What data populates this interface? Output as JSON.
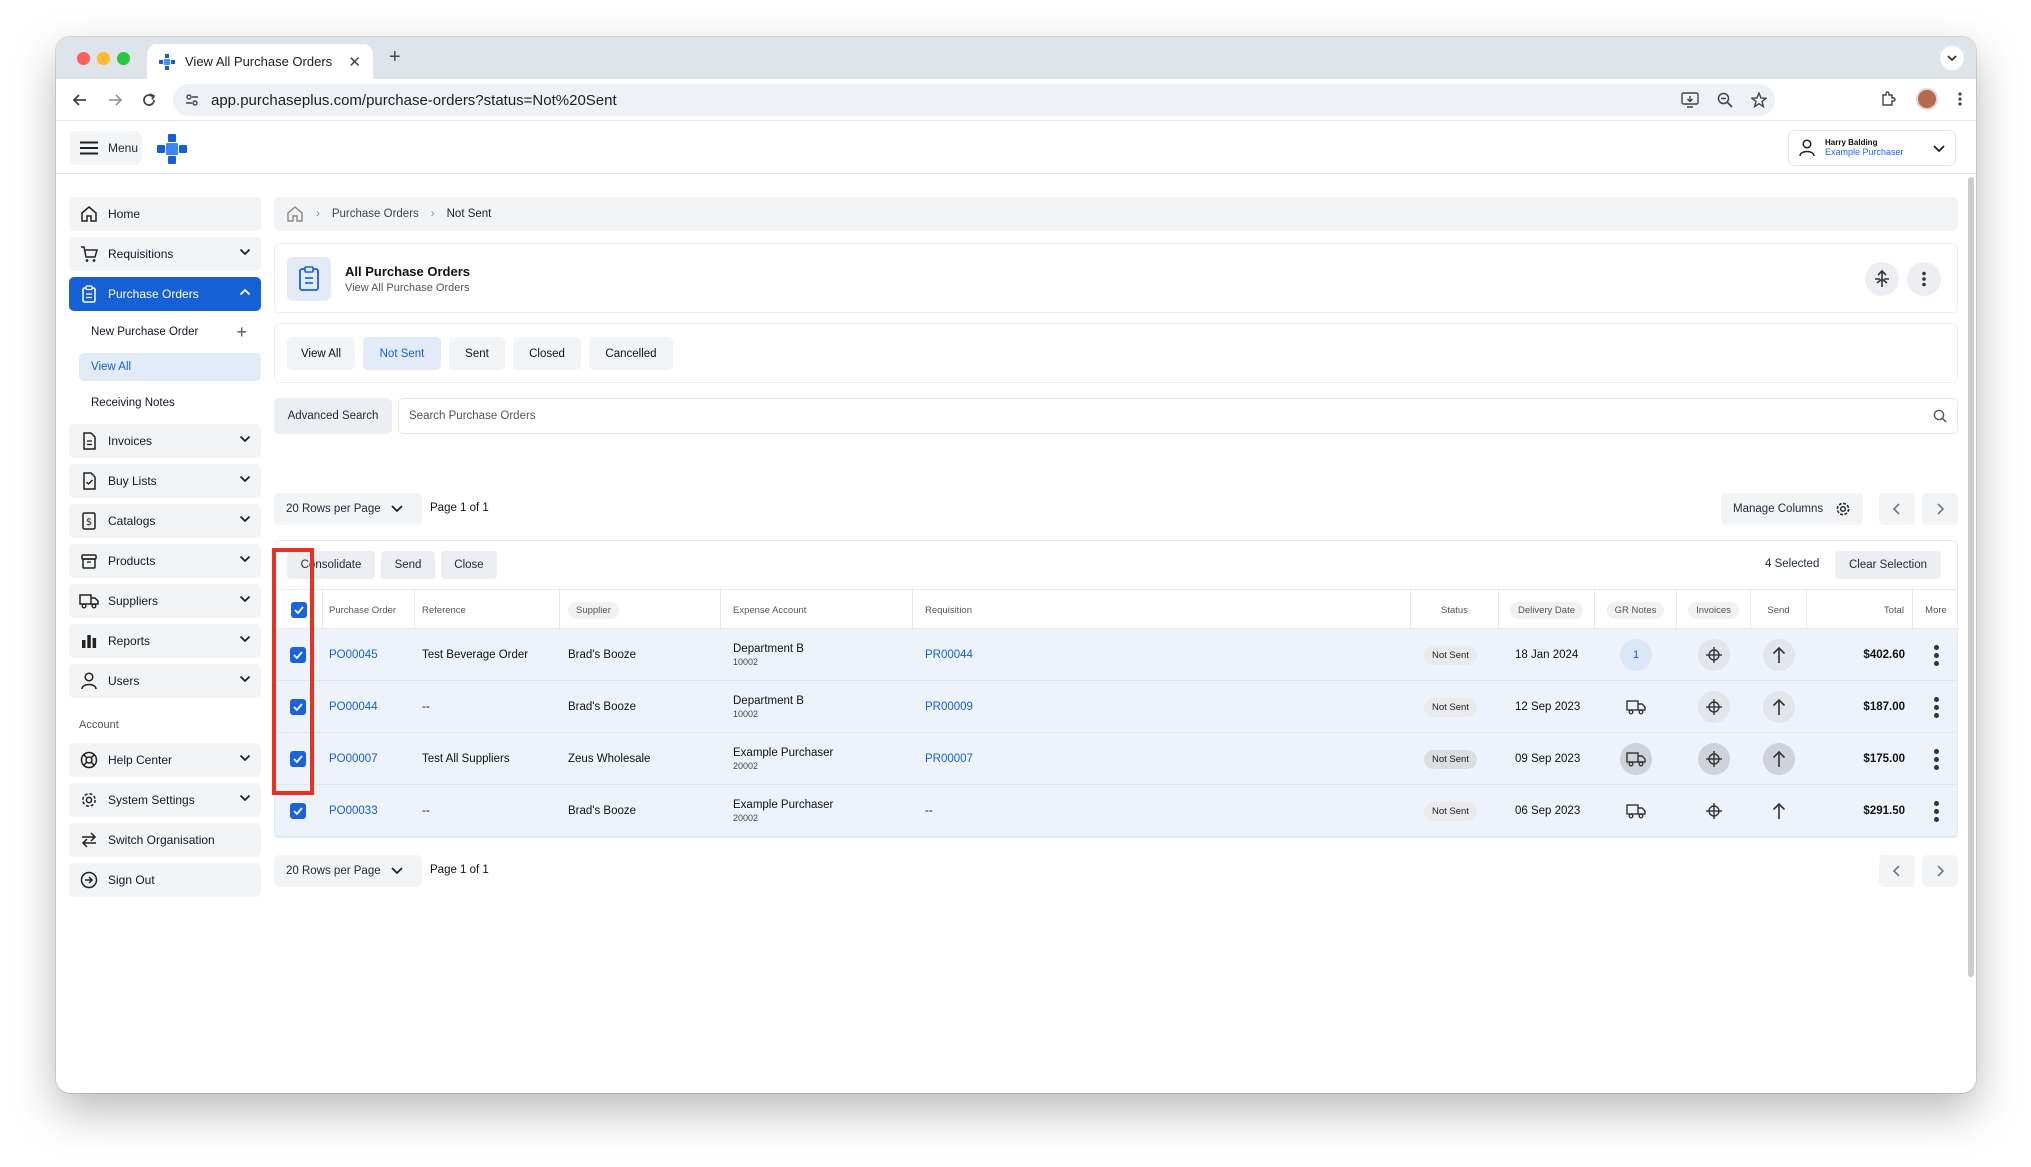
{
  "browser": {
    "tab_title": "View All Purchase Orders",
    "url": "app.purchaseplus.com/purchase-orders?status=Not%20Sent"
  },
  "header": {
    "menu_label": "Menu",
    "user_name": "Harry Balding",
    "user_role": "Example Purchaser"
  },
  "sidebar": {
    "items": [
      {
        "label": "Home"
      },
      {
        "label": "Requisitions"
      },
      {
        "label": "Purchase Orders"
      },
      {
        "label": "Invoices"
      },
      {
        "label": "Buy Lists"
      },
      {
        "label": "Catalogs"
      },
      {
        "label": "Products"
      },
      {
        "label": "Suppliers"
      },
      {
        "label": "Reports"
      },
      {
        "label": "Users"
      }
    ],
    "sub_items": [
      {
        "label": "New Purchase Order"
      },
      {
        "label": "View All"
      },
      {
        "label": "Receiving Notes"
      }
    ],
    "account_label": "Account",
    "account_items": [
      {
        "label": "Help Center"
      },
      {
        "label": "System Settings"
      },
      {
        "label": "Switch Organisation"
      },
      {
        "label": "Sign Out"
      }
    ]
  },
  "breadcrumb": {
    "level1": "Purchase Orders",
    "level2": "Not Sent"
  },
  "page": {
    "title": "All Purchase Orders",
    "subtitle": "View All Purchase Orders"
  },
  "filter_tabs": [
    "View All",
    "Not Sent",
    "Sent",
    "Closed",
    "Cancelled"
  ],
  "active_filter": "Not Sent",
  "search": {
    "advanced_label": "Advanced Search",
    "placeholder": "Search Purchase Orders"
  },
  "pagination": {
    "rows_per_page": "20 Rows per Page",
    "page_info": "Page 1 of 1",
    "manage_columns": "Manage Columns"
  },
  "actions": {
    "consolidate": "Consolidate",
    "send": "Send",
    "close": "Close",
    "selected": "4 Selected",
    "clear_selection": "Clear Selection"
  },
  "table": {
    "columns": {
      "purchase_order": "Purchase Order",
      "reference": "Reference",
      "supplier": "Supplier",
      "expense_account": "Expense Account",
      "requisition": "Requisition",
      "status": "Status",
      "delivery_date": "Delivery Date",
      "gr_notes": "GR Notes",
      "invoices": "Invoices",
      "send": "Send",
      "total": "Total",
      "more": "More"
    },
    "rows": [
      {
        "po": "PO00045",
        "reference": "Test Beverage Order",
        "supplier": "Brad's Booze",
        "account": "Department B",
        "account_code": "10002",
        "requisition": "PR00044",
        "status": "Not Sent",
        "delivery": "18 Jan 2024",
        "gr_notes": "1",
        "total": "$402.60"
      },
      {
        "po": "PO00044",
        "reference": "--",
        "supplier": "Brad's Booze",
        "account": "Department B",
        "account_code": "10002",
        "requisition": "PR00009",
        "status": "Not Sent",
        "delivery": "12 Sep 2023",
        "gr_notes": "",
        "total": "$187.00"
      },
      {
        "po": "PO00007",
        "reference": "Test All Suppliers",
        "supplier": "Zeus Wholesale",
        "account": "Example Purchaser",
        "account_code": "20002",
        "requisition": "PR00007",
        "status": "Not Sent",
        "delivery": "09 Sep 2023",
        "gr_notes": "",
        "total": "$175.00"
      },
      {
        "po": "PO00033",
        "reference": "--",
        "supplier": "Brad's Booze",
        "account": "Example Purchaser",
        "account_code": "20002",
        "requisition": "--",
        "status": "Not Sent",
        "delivery": "06 Sep 2023",
        "gr_notes": "",
        "total": "$291.50"
      }
    ]
  },
  "colors": {
    "accent": "#1560d4",
    "highlight_box": "#e8311f",
    "row_selected": "#eef3fb"
  }
}
